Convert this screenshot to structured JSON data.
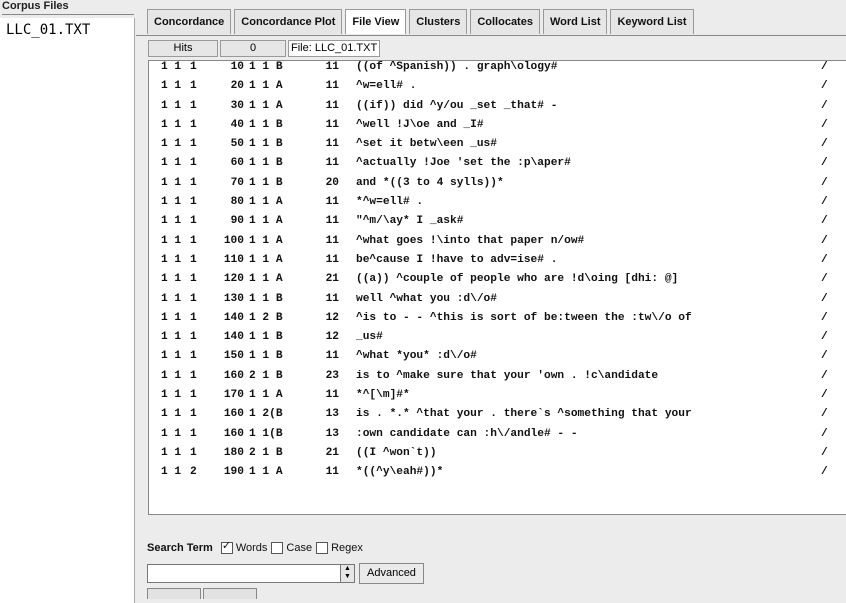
{
  "corpus_panel": {
    "header": "Corpus Files",
    "files": [
      "LLC_01.TXT"
    ]
  },
  "tabs": [
    {
      "label": "Concordance",
      "active": false
    },
    {
      "label": "Concordance Plot",
      "active": false
    },
    {
      "label": "File View",
      "active": true
    },
    {
      "label": "Clusters",
      "active": false
    },
    {
      "label": "Collocates",
      "active": false
    },
    {
      "label": "Word List",
      "active": false
    },
    {
      "label": "Keyword List",
      "active": false
    }
  ],
  "hits_bar": {
    "hits_label": "Hits",
    "hits_value": "0",
    "file_label": "File: LLC_01.TXT"
  },
  "text_rows": [
    {
      "a": "1 1",
      "b": "1",
      "n": "10",
      "d": "1 1 B",
      "t": "11",
      "text": "((of ^Spanish)) . graph\\ology#",
      "end": "/"
    },
    {
      "a": "1 1",
      "b": "1",
      "n": "20",
      "d": "1 1 A",
      "t": "11",
      "text": "^w=ell# .",
      "end": "/"
    },
    {
      "a": "1 1",
      "b": "1",
      "n": "30",
      "d": "1 1 A",
      "t": "11",
      "text": "((if)) did ^y/ou _set _that# -",
      "end": "/"
    },
    {
      "a": "1 1",
      "b": "1",
      "n": "40",
      "d": "1 1 B",
      "t": "11",
      "text": "^well !J\\oe and _I#",
      "end": "/"
    },
    {
      "a": "1 1",
      "b": "1",
      "n": "50",
      "d": "1 1 B",
      "t": "11",
      "text": "^set it betw\\een _us#",
      "end": "/"
    },
    {
      "a": "1 1",
      "b": "1",
      "n": "60",
      "d": "1 1 B",
      "t": "11",
      "text": "^actually !Joe 'set the :p\\aper#",
      "end": "/"
    },
    {
      "a": "1 1",
      "b": "1",
      "n": "70",
      "d": "1 1 B",
      "t": "20",
      "text": "and *((3 to 4 sylls))*",
      "end": "/"
    },
    {
      "a": "1 1",
      "b": "1",
      "n": "80",
      "d": "1 1 A",
      "t": "11",
      "text": "*^w=ell# .",
      "end": "/"
    },
    {
      "a": "1 1",
      "b": "1",
      "n": "90",
      "d": "1 1 A",
      "t": "11",
      "text": "\"^m/\\ay* I _ask#",
      "end": "/"
    },
    {
      "a": "1 1",
      "b": "1",
      "n": "100",
      "d": "1 1 A",
      "t": "11",
      "text": "^what goes !\\into that paper n/ow#",
      "end": "/"
    },
    {
      "a": "1 1",
      "b": "1",
      "n": "110",
      "d": "1 1 A",
      "t": "11",
      "text": "be^cause I !have to adv=ise# .",
      "end": "/"
    },
    {
      "a": "1 1",
      "b": "1",
      "n": "120",
      "d": "1 1 A",
      "t": "21",
      "text": "((a)) ^couple of people who are !d\\oing [dhi: @]",
      "end": "/"
    },
    {
      "a": "1 1",
      "b": "1",
      "n": "130",
      "d": "1 1 B",
      "t": "11",
      "text": "well ^what you :d\\/o#",
      "end": "/"
    },
    {
      "a": "1 1",
      "b": "1",
      "n": "140",
      "d": "1 2 B",
      "t": "12",
      "text": "^is to - - ^this is sort of be:tween the :tw\\/o of",
      "end": "/"
    },
    {
      "a": "1 1",
      "b": "1",
      "n": "140",
      "d": "1 1 B",
      "t": "12",
      "text": "_us#",
      "end": "/"
    },
    {
      "a": "1 1",
      "b": "1",
      "n": "150",
      "d": "1 1 B",
      "t": "11",
      "text": "^what *you* :d\\/o#",
      "end": "/"
    },
    {
      "a": "1 1",
      "b": "1",
      "n": "160",
      "d": "2 1 B",
      "t": "23",
      "text": "is to ^make sure that your 'own . !c\\andidate",
      "end": "/"
    },
    {
      "a": "1 1",
      "b": "1",
      "n": "170",
      "d": "1 1 A",
      "t": "11",
      "text": "*^[\\m]#*",
      "end": "/"
    },
    {
      "a": "1 1",
      "b": "1",
      "n": "160",
      "d": "1 2(B",
      "t": "13",
      "text": "is . *.* ^that your . there`s ^something that your",
      "end": "/"
    },
    {
      "a": "1 1",
      "b": "1",
      "n": "160",
      "d": "1 1(B",
      "t": "13",
      "text": ":own candidate can :h\\/andle# - -",
      "end": "/"
    },
    {
      "a": "1 1",
      "b": "1",
      "n": "180",
      "d": "2 1 B",
      "t": "21",
      "text": "((I ^won`t))",
      "end": "/"
    },
    {
      "a": "1 1",
      "b": "2",
      "n": "190",
      "d": "1 1 A",
      "t": "11",
      "text": "*((^y\\eah#))*",
      "end": "/"
    }
  ],
  "search": {
    "label": "Search Term",
    "words_label": "Words",
    "words_checked": true,
    "case_label": "Case",
    "case_checked": false,
    "regex_label": "Regex",
    "regex_checked": false,
    "input_value": "",
    "advanced_label": "Advanced"
  }
}
